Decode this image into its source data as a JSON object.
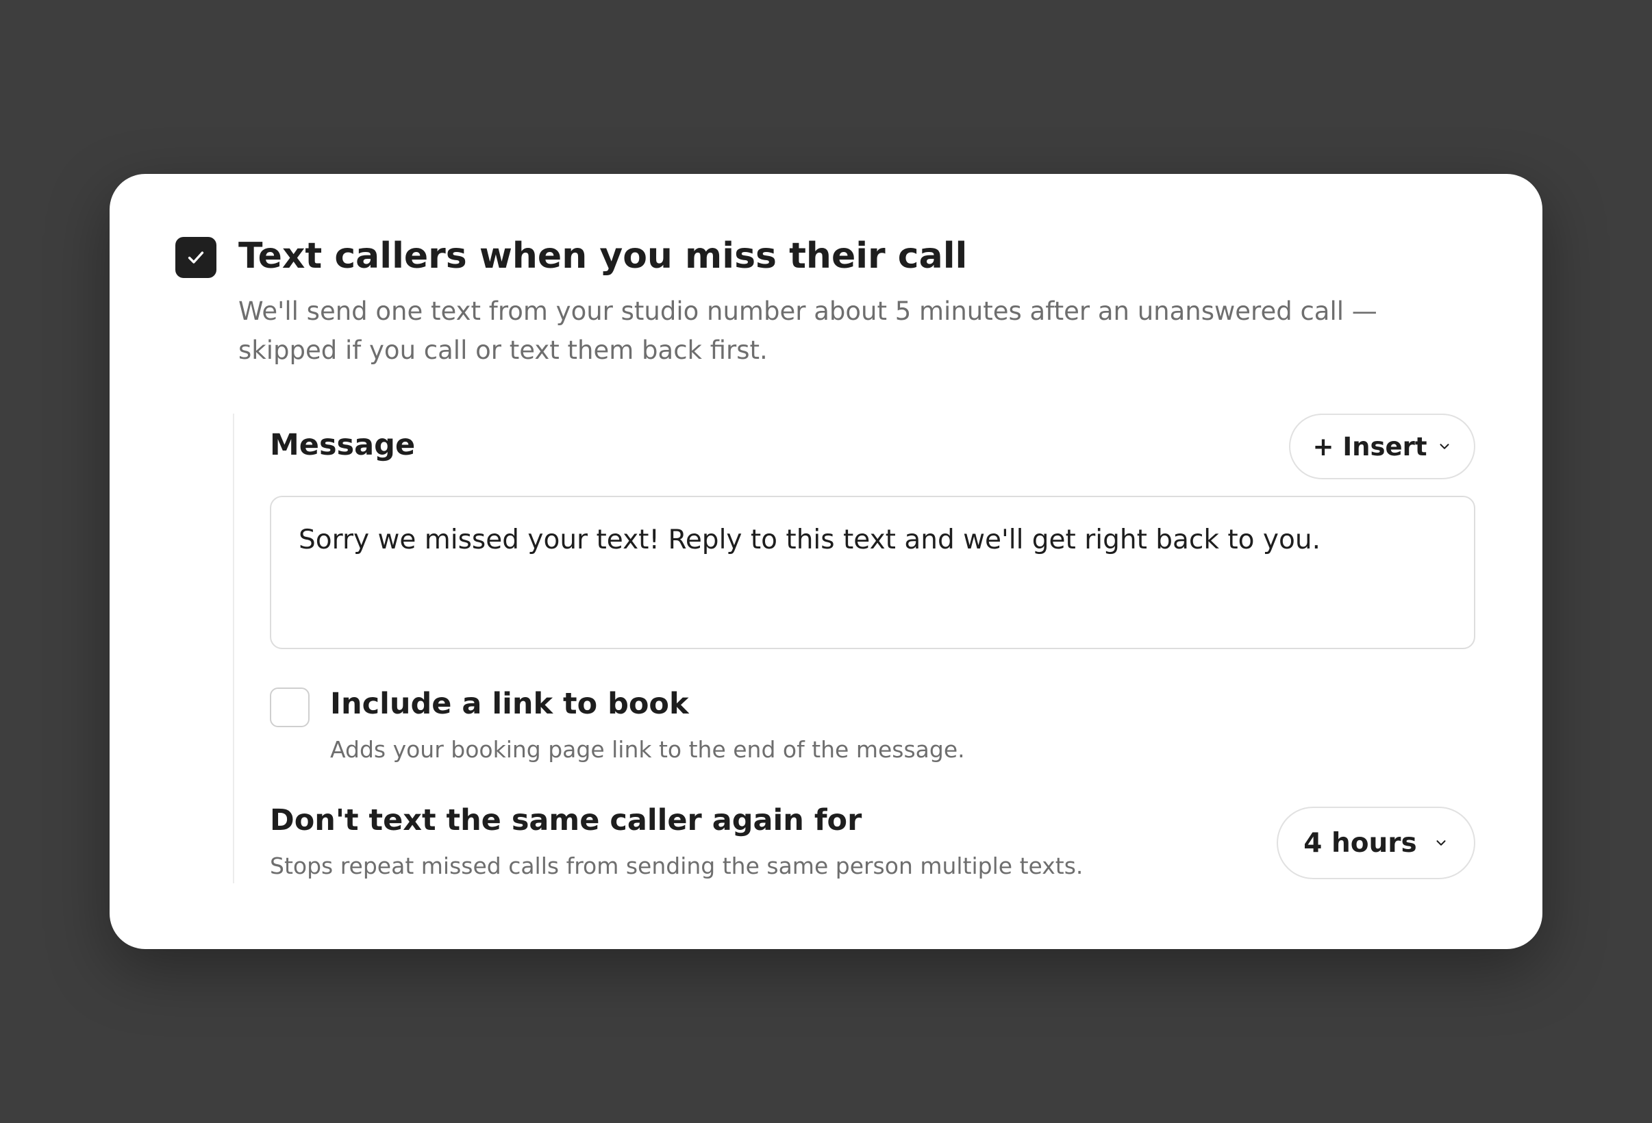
{
  "missed_call_text": {
    "enabled": true,
    "title": "Text callers when you miss their call",
    "description": "We'll send one text from your studio number about 5 minutes after an unanswered call — skipped if you call or text them back first."
  },
  "message": {
    "label": "Message",
    "insert_button_label": "+ Insert",
    "text": "Sorry we missed your text! Reply to this text and we'll get right back to you."
  },
  "booking_link": {
    "checked": false,
    "label": "Include a link to book",
    "description": "Adds your booking page link to the end of the message."
  },
  "cooldown": {
    "label": "Don't text the same caller again for",
    "description": "Stops repeat missed calls from sending the same person multiple texts.",
    "selected_value": "4 hours"
  },
  "icons": {
    "checkmark": "check-icon",
    "dropdown": "chevron-down-icon"
  },
  "colors": {
    "backdrop": "#3e3e3e",
    "card": "#ffffff",
    "checkbox_checked": "#1f1f1f",
    "text_primary": "#1e1e1e",
    "text_secondary": "#6e6e6e"
  }
}
